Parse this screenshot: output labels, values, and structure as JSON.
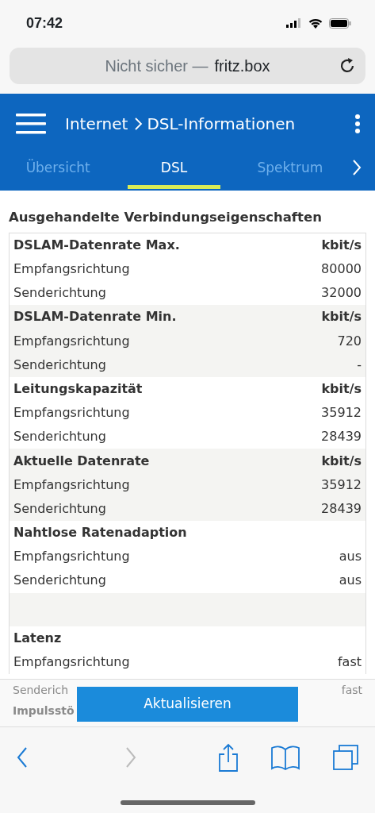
{
  "status_bar": {
    "time": "07:42"
  },
  "browser": {
    "url_prefix": "Nicht sicher —",
    "url_host": "fritz.box"
  },
  "header": {
    "breadcrumb": "Internet",
    "page": "DSL-Informationen"
  },
  "tabs": [
    {
      "label": "Übersicht",
      "selected": false
    },
    {
      "label": "DSL",
      "selected": true
    },
    {
      "label": "Spektrum",
      "selected": false
    }
  ],
  "section_title": "Ausgehandelte Verbindungseigenschaften",
  "groups": [
    {
      "kind": "group",
      "title": "DSLAM-Datenrate Max.",
      "unit": "kbit/s",
      "rows": [
        {
          "label": "Empfangsrichtung",
          "value": "80000"
        },
        {
          "label": "Senderichtung",
          "value": "32000"
        }
      ]
    },
    {
      "kind": "group",
      "title": "DSLAM-Datenrate Min.",
      "unit": "kbit/s",
      "rows": [
        {
          "label": "Empfangsrichtung",
          "value": "720"
        },
        {
          "label": "Senderichtung",
          "value": "-"
        }
      ]
    },
    {
      "kind": "group",
      "title": "Leitungskapazität",
      "unit": "kbit/s",
      "rows": [
        {
          "label": "Empfangsrichtung",
          "value": "35912"
        },
        {
          "label": "Senderichtung",
          "value": "28439"
        }
      ]
    },
    {
      "kind": "group",
      "title": "Aktuelle Datenrate",
      "unit": "kbit/s",
      "rows": [
        {
          "label": "Empfangsrichtung",
          "value": "35912"
        },
        {
          "label": "Senderichtung",
          "value": "28439"
        }
      ]
    },
    {
      "kind": "group",
      "title": "Nahtlose Ratenadaption",
      "rows": [
        {
          "label": "Empfangsrichtung",
          "value": "aus"
        },
        {
          "label": "Senderichtung",
          "value": "aus"
        }
      ]
    },
    {
      "kind": "spacer"
    },
    {
      "kind": "group",
      "title": "Latenz",
      "rows": [
        {
          "label": "Empfangsrichtung",
          "value": "fast"
        }
      ]
    }
  ],
  "covered_rows": [
    {
      "label": "Senderich",
      "value": "fast"
    },
    {
      "label": "Impulsstö"
    }
  ],
  "footer": {
    "button": "Aktualisieren"
  }
}
